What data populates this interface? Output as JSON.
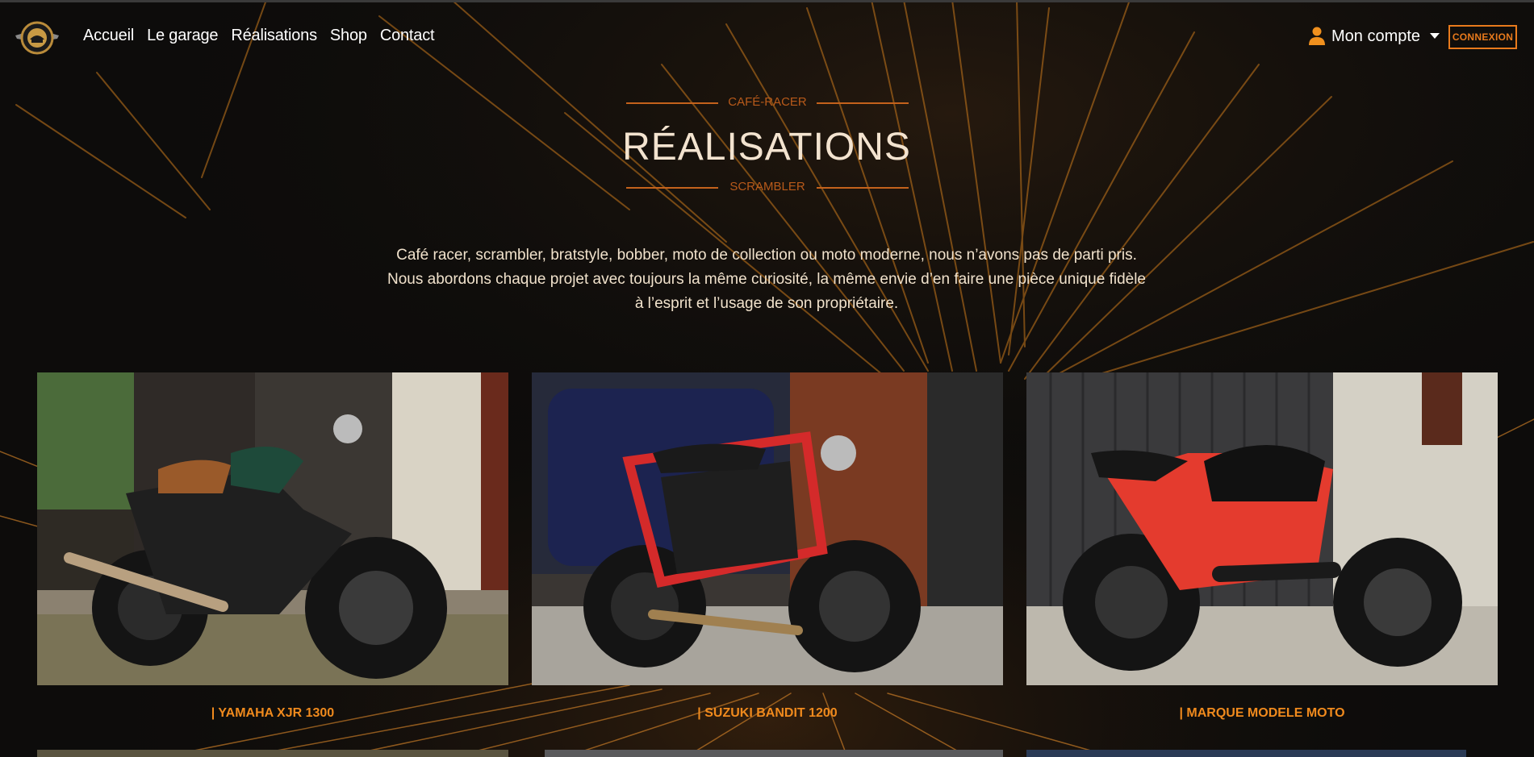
{
  "nav": {
    "logo": "logo-emblem",
    "links": [
      "Accueil",
      "Le garage",
      "Réalisations",
      "Shop",
      "Contact"
    ],
    "account_label": "Mon compte",
    "login_label": "CONNEXION"
  },
  "header": {
    "kicker_top": "CAFÉ-RACER",
    "title": "RÉALISATIONS",
    "kicker_bottom": "SCRAMBLER"
  },
  "intro": {
    "line1": "Café racer, scrambler, bratstyle, bobber, moto de collection ou moto moderne, nous n’avons pas de parti pris.",
    "line2": "Nous abordons chaque projet avec toujours la même curiosité, la même envie d’en faire une pièce unique fidèle à l’esprit et l’usage de son propriétaire."
  },
  "projects": [
    {
      "title": "| YAMAHA XJR 1300"
    },
    {
      "title": "| SUZUKI BANDIT 1200"
    },
    {
      "title": "| MARQUE MODELE MOTO"
    }
  ],
  "colors": {
    "accent": "#e87a1c",
    "background": "#0d0c0b",
    "text": "#f1e2cc"
  }
}
